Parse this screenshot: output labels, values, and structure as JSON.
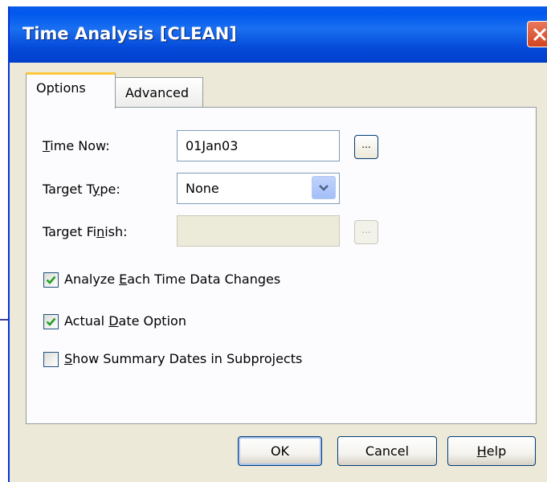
{
  "window": {
    "title": "Time Analysis [CLEAN]"
  },
  "tabs": [
    {
      "label": "Options",
      "selected": true
    },
    {
      "label": "Advanced",
      "selected": false
    }
  ],
  "fields": {
    "time_now": {
      "label_pre": "",
      "label_key": "T",
      "label_post": "ime Now:",
      "value": "01Jan03"
    },
    "target_type": {
      "label_pre": "Target T",
      "label_key": "y",
      "label_post": "pe:",
      "value": "None"
    },
    "target_finish": {
      "label_pre": "Target Fi",
      "label_key": "n",
      "label_post": "ish:",
      "value": ""
    }
  },
  "ellipsis_label": "...",
  "checkboxes": [
    {
      "pre": "Analyze ",
      "key": "E",
      "post": "ach Time Data Changes",
      "checked": true
    },
    {
      "pre": "Actual ",
      "key": "D",
      "post": "ate Option",
      "checked": true
    },
    {
      "pre": "",
      "key": "S",
      "post": "how Summary Dates in Subprojects",
      "checked": false
    }
  ],
  "buttons": {
    "ok": "OK",
    "cancel": "Cancel",
    "help_key": "H",
    "help_post": "elp"
  },
  "colors": {
    "titlebar": "#0058ee",
    "check_mark": "#21a121",
    "close_button": "#d2451f",
    "tab_highlight": "#ffc83c"
  }
}
